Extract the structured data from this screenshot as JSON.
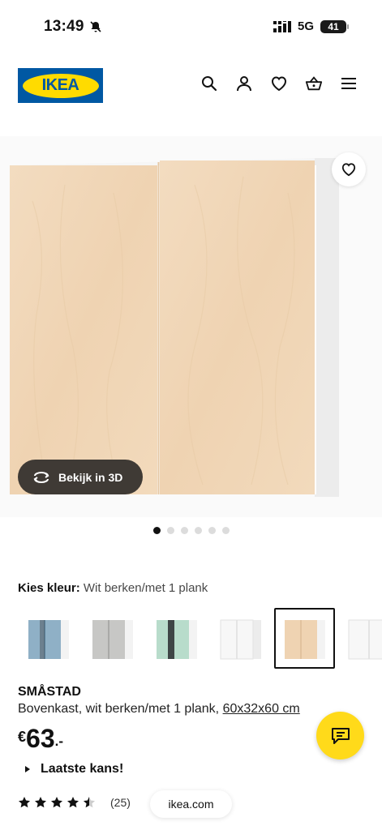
{
  "status_bar": {
    "time": "13:49",
    "network": "5G",
    "battery": "41"
  },
  "header": {
    "logo_text": "IKEA",
    "icons": [
      "search-icon",
      "account-icon",
      "heart-icon",
      "cart-icon",
      "menu-icon"
    ]
  },
  "gallery": {
    "view_3d_label": "Bekijk in 3D",
    "image_count": 6,
    "active_index": 0
  },
  "color_picker": {
    "label": "Kies kleur:",
    "selected_value": "Wit berken/met 1 plank",
    "swatches": [
      "light blue",
      "light grey",
      "mint green",
      "white",
      "white birch",
      "white"
    ]
  },
  "product": {
    "name": "SMÅSTAD",
    "description": "Bovenkast, wit berken/met 1 plank, ",
    "dimensions": "60x32x60 cm",
    "currency": "€",
    "price_whole": "63",
    "price_decimal": ".-",
    "availability": "Laatste kans!",
    "rating_count": "(25)",
    "rating_stars": 4.5
  },
  "browser": {
    "url": "ikea.com"
  },
  "colors": {
    "brand_blue": "#0058a3",
    "brand_yellow": "#ffdb00",
    "chat_yellow": "#ffda1a"
  }
}
